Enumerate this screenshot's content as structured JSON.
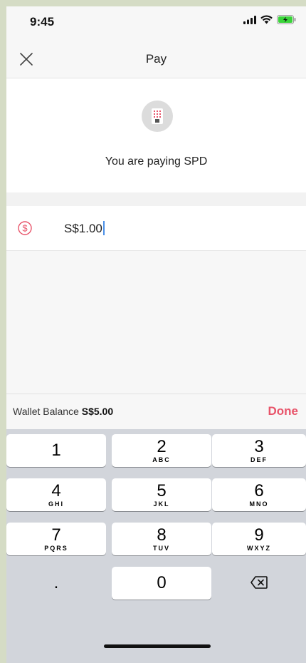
{
  "status_bar": {
    "time": "9:45"
  },
  "header": {
    "title": "Pay"
  },
  "merchant": {
    "paying_text": "You are paying SPD"
  },
  "amount": {
    "value": "S$1.00"
  },
  "balance": {
    "label": "Wallet Balance",
    "amount": "S$5.00",
    "done_label": "Done"
  },
  "keypad": {
    "keys": [
      {
        "digit": "1",
        "letters": ""
      },
      {
        "digit": "2",
        "letters": "ABC"
      },
      {
        "digit": "3",
        "letters": "DEF"
      },
      {
        "digit": "4",
        "letters": "GHI"
      },
      {
        "digit": "5",
        "letters": "JKL"
      },
      {
        "digit": "6",
        "letters": "MNO"
      },
      {
        "digit": "7",
        "letters": "PQRS"
      },
      {
        "digit": "8",
        "letters": "TUV"
      },
      {
        "digit": "9",
        "letters": "WXYZ"
      }
    ],
    "decimal": ".",
    "zero": "0"
  },
  "colors": {
    "accent": "#e8546a",
    "keypad_bg": "#d2d5db",
    "battery_green": "#3ad43a"
  }
}
